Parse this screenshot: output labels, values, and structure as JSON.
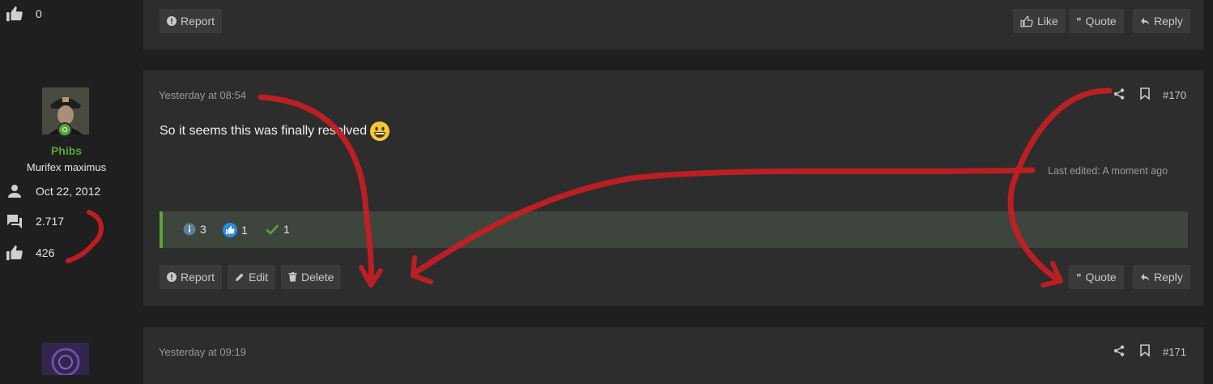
{
  "prev_post": {
    "like_count": "0",
    "actions_left": [
      {
        "label": "Report",
        "icon": "report-icon"
      }
    ],
    "actions_right": [
      {
        "label": "Like",
        "icon": "like-icon"
      },
      {
        "label": "Quote",
        "icon": "quote-icon"
      },
      {
        "label": "Reply",
        "icon": "reply-icon"
      }
    ]
  },
  "post": {
    "user": {
      "name": "Phibs",
      "title": "Murifex maximus",
      "joined": "Oct 22, 2012",
      "messages": "2.717",
      "reactions": "426",
      "name_color": "#5aa43c"
    },
    "timestamp": "Yesterday at 08:54",
    "post_number": "#170",
    "body": "So it seems this was finally resolved",
    "emoji": "grinning-face",
    "last_edited": "Last edited: A moment ago",
    "reactions": [
      {
        "icon": "info-reaction-icon",
        "count": "3"
      },
      {
        "icon": "like-reaction-icon",
        "count": "1"
      },
      {
        "icon": "check-reaction-icon",
        "count": "1"
      }
    ],
    "actions_left": [
      {
        "label": "Report",
        "icon": "report-icon"
      },
      {
        "label": "Edit",
        "icon": "edit-icon"
      },
      {
        "label": "Delete",
        "icon": "delete-icon"
      }
    ],
    "actions_right": [
      {
        "label": "Quote",
        "icon": "quote-icon"
      },
      {
        "label": "Reply",
        "icon": "reply-icon"
      }
    ]
  },
  "next_post": {
    "timestamp": "Yesterday at 09:19",
    "post_number": "#171"
  },
  "colors": {
    "background": "#1f1f1f",
    "card": "#2d2d2d",
    "button": "#3a3a3a",
    "reaction_bar": "#3d453d",
    "reaction_accent": "#5aa43c",
    "annotation": "#c81e24"
  }
}
